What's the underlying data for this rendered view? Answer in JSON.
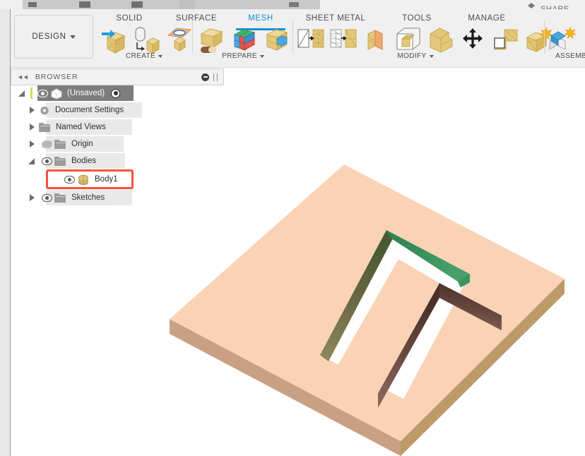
{
  "app": {
    "title_bar_cut": true,
    "share_label": "SHARE"
  },
  "ribbon": {
    "design_button": {
      "label": "DESIGN",
      "icon": "chevron-down-icon"
    },
    "tabs": [
      {
        "id": "solid",
        "label": "SOLID",
        "active": false
      },
      {
        "id": "surface",
        "label": "SURFACE",
        "active": false
      },
      {
        "id": "mesh",
        "label": "MESH",
        "active": true
      },
      {
        "id": "sheet-metal",
        "label": "SHEET METAL",
        "active": false
      },
      {
        "id": "tools",
        "label": "TOOLS",
        "active": false
      },
      {
        "id": "manage",
        "label": "MANAGE",
        "active": false
      }
    ],
    "groups": [
      {
        "id": "create",
        "label": "CREATE",
        "has_dropdown": true,
        "items": [
          {
            "name": "create-mesh-icon",
            "title": "Create Mesh"
          },
          {
            "name": "brep-to-mesh-icon",
            "title": "BRep to Mesh"
          },
          {
            "name": "mesh-section-sketch-icon",
            "title": "Mesh Section Sketch"
          }
        ]
      },
      {
        "id": "prepare",
        "label": "PREPARE",
        "has_dropdown": true,
        "items": [
          {
            "name": "erase-and-fill-icon",
            "title": "Erase and Fill"
          },
          {
            "name": "segment-mesh-icon",
            "title": "Segment Mesh"
          },
          {
            "name": "separate-icon",
            "title": "Separate"
          }
        ]
      },
      {
        "id": "modify",
        "label": "MODIFY",
        "has_dropdown": true,
        "items": [
          {
            "name": "remesh-icon",
            "title": "Remesh"
          },
          {
            "name": "reduce-icon",
            "title": "Reduce"
          },
          {
            "name": "make-closed-mesh-icon",
            "title": "Make Closed Mesh"
          },
          {
            "name": "plane-cut-icon",
            "title": "Plane Cut"
          },
          {
            "name": "smooth-icon",
            "title": "Smooth"
          },
          {
            "name": "move-copy-icon",
            "title": "Move / Copy"
          },
          {
            "name": "delete-icon",
            "title": "Delete"
          },
          {
            "name": "generate-face-groups-icon",
            "title": "Generate Face Groups"
          }
        ]
      },
      {
        "id": "assemble",
        "label": "ASSEMB",
        "has_dropdown": false,
        "items": [
          {
            "name": "new-component-icon",
            "title": "New Component"
          },
          {
            "name": "joint-icon",
            "title": "Joint"
          }
        ]
      }
    ]
  },
  "browser": {
    "header": {
      "title": "BROWSER",
      "collapse_icon": "collapse-left-icon",
      "minimize_icon": "minimize-icon",
      "grip_icon": "panel-grip-icon"
    },
    "tree": [
      {
        "id": "unsaved",
        "label": "(Unsaved)",
        "indent": 0,
        "expander": "open",
        "eye": "on",
        "icon": "document-cube-icon",
        "selected": true,
        "has_radio": true,
        "has_yellow_bar": true
      },
      {
        "id": "document-settings",
        "label": "Document Settings",
        "indent": 1,
        "expander": "closed",
        "eye": "none",
        "icon": "gear-icon",
        "selected": false,
        "has_radio": false,
        "has_yellow_bar": false
      },
      {
        "id": "named-views",
        "label": "Named Views",
        "indent": 1,
        "expander": "closed",
        "eye": "none",
        "icon": "folder-icon",
        "selected": false,
        "has_radio": false,
        "has_yellow_bar": false
      },
      {
        "id": "origin",
        "label": "Origin",
        "indent": 1,
        "expander": "closed",
        "eye": "off",
        "icon": "folder-icon",
        "selected": false,
        "has_radio": false,
        "has_yellow_bar": false
      },
      {
        "id": "bodies",
        "label": "Bodies",
        "indent": 1,
        "expander": "open",
        "eye": "on",
        "icon": "folder-icon",
        "selected": false,
        "has_radio": false,
        "has_yellow_bar": false
      },
      {
        "id": "body1",
        "label": "Body1",
        "indent": 2,
        "expander": "none",
        "eye": "on",
        "icon": "body-icon",
        "selected": false,
        "has_radio": false,
        "has_yellow_bar": false,
        "highlighted": true
      },
      {
        "id": "sketches",
        "label": "Sketches",
        "indent": 1,
        "expander": "closed",
        "eye": "on",
        "icon": "folder-icon",
        "selected": false,
        "has_radio": false,
        "has_yellow_bar": false
      }
    ],
    "highlight_color": "#f4553c"
  },
  "canvas": {
    "background": "#ffffff",
    "model": {
      "name": "rectangular-plate-with-slot",
      "faces": {
        "top": "#fad3b6",
        "left_side": "#c9a084",
        "right_side": "#bc9a6a",
        "slot_wall_dark": "#5e4038",
        "slot_wall_olive": "#6d6a44",
        "slot_through": "#ffffff",
        "selected_face": "#2f8b52",
        "selected_face_edge": "#3f9a5e"
      },
      "selected_face_label": "highlighted-green-face"
    }
  }
}
